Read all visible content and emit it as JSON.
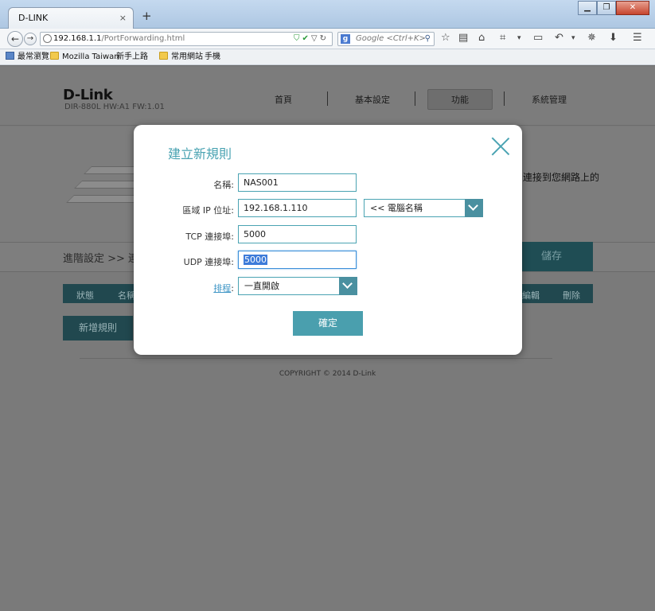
{
  "browser": {
    "tab_title": "D-LINK",
    "tab_close": "×",
    "new_tab": "+",
    "url_host": "192.168.1.1",
    "url_path": "/PortForwarding.html",
    "search_placeholder": "Google <Ctrl+K>",
    "win_min": "▁",
    "win_max": "❐",
    "win_close": "✕",
    "bookmarks": [
      "最常瀏覽",
      "Mozilla Taiwan",
      "新手上路",
      "常用網站",
      "手機"
    ]
  },
  "page": {
    "logo": "D-Link",
    "model": "DIR-880L   HW:A1   FW:1.01",
    "nav": [
      "首頁",
      "基本設定",
      "功能",
      "系統管理"
    ],
    "banner_text": "連接到您網路上的",
    "breadcrumb": "進階設定 >> 連",
    "save_label": "儲存",
    "table_headers": [
      "狀態",
      "名稱",
      "編輯",
      "刪除"
    ],
    "add_rule": "新增規則",
    "copyright": "COPYRIGHT © 2014 D-Link"
  },
  "dialog": {
    "title": "建立新規則",
    "name_label": "名稱:",
    "name_value": "NAS001",
    "ip_label": "區域 IP 位址:",
    "ip_value": "192.168.1.110",
    "computer_select": "<< 電腦名稱",
    "tcp_label": "TCP 連接埠:",
    "tcp_value": "5000",
    "udp_label": "UDP 連接埠:",
    "udp_value": "5000",
    "schedule_link": "排程",
    "schedule_colon": ":",
    "schedule_value": "一直開啟",
    "ok_label": "確定"
  },
  "colors": {
    "accent": "#4aa3b2",
    "dialog_button": "#4a9fae",
    "link": "#3f96c6"
  }
}
